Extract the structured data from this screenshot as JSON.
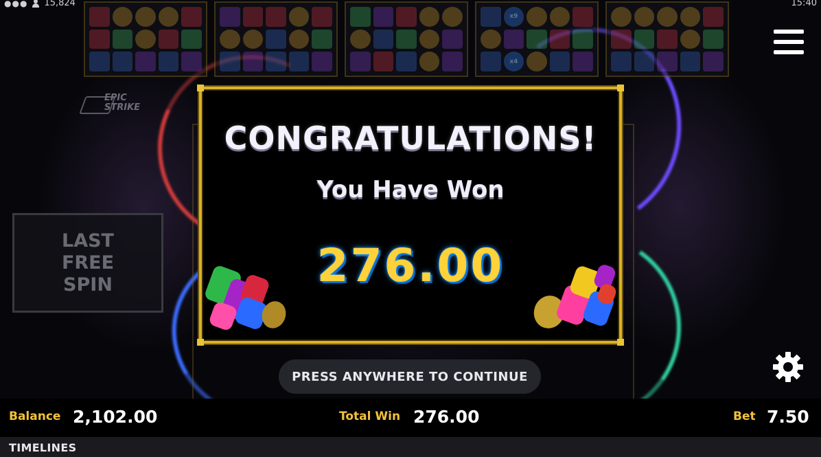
{
  "status_bar": {
    "player_count": "15,824",
    "clock": "15:40"
  },
  "icons": {
    "menu": "hamburger-menu-icon",
    "settings": "gear-icon",
    "players": "user-icon"
  },
  "side_panel": {
    "last_free_spin": "LAST FREE SPIN"
  },
  "popup": {
    "title": "CONGRATULATIONS!",
    "subtitle": "You Have Won",
    "amount": "276.00"
  },
  "continue_prompt": "PRESS ANYWHERE TO CONTINUE",
  "bottom_bar": {
    "balance_label": "Balance",
    "balance_value": "2,102.00",
    "total_win_label": "Total Win",
    "total_win_value": "276.00",
    "bet_label": "Bet",
    "bet_value": "7.50"
  },
  "footer": {
    "title": "TIMELINES"
  },
  "colors": {
    "accent_gold": "#f3c23a",
    "popup_border": "#d9b227",
    "amount_glow": "#1a8cff"
  }
}
